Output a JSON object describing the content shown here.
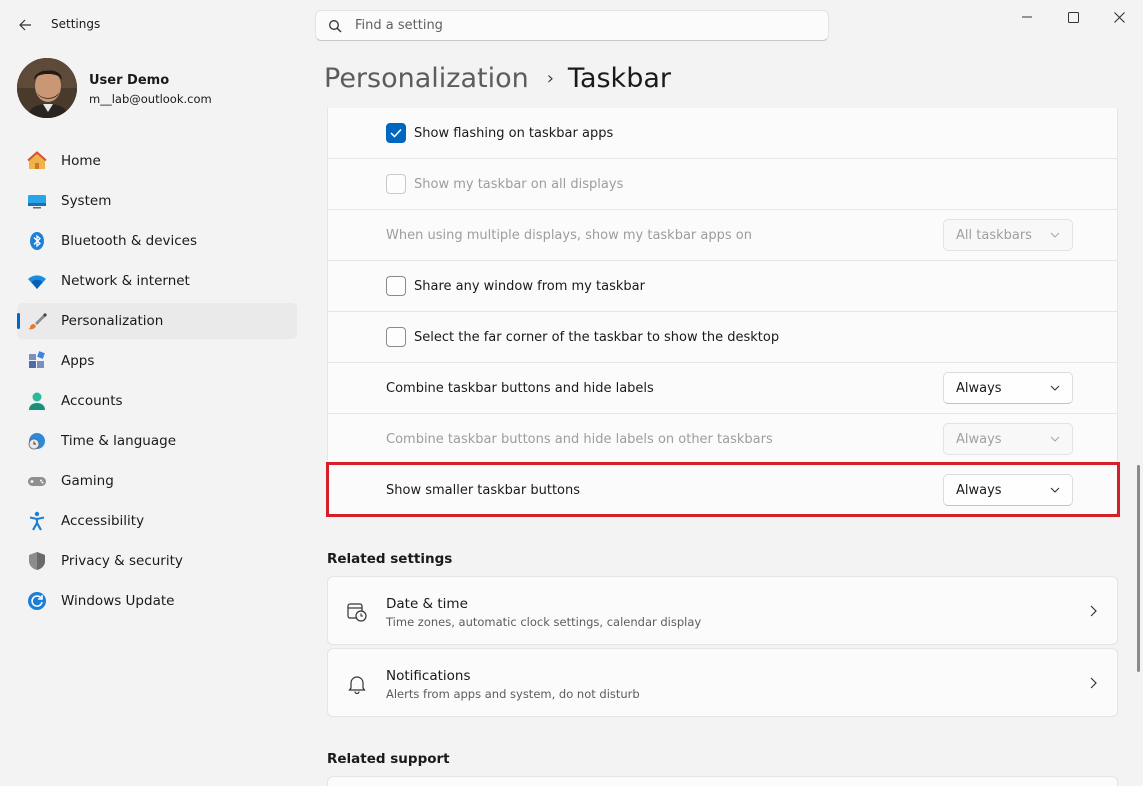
{
  "window": {
    "app_title": "Settings",
    "search_placeholder": "Find a setting"
  },
  "profile": {
    "name": "User Demo",
    "email": "m__lab@outlook.com"
  },
  "sidebar": {
    "items": [
      {
        "label": "Home",
        "icon": "home-icon"
      },
      {
        "label": "System",
        "icon": "system-display-icon"
      },
      {
        "label": "Bluetooth & devices",
        "icon": "bluetooth-icon"
      },
      {
        "label": "Network & internet",
        "icon": "wifi-icon"
      },
      {
        "label": "Personalization",
        "icon": "paintbrush-icon",
        "selected": true
      },
      {
        "label": "Apps",
        "icon": "apps-icon"
      },
      {
        "label": "Accounts",
        "icon": "person-icon"
      },
      {
        "label": "Time & language",
        "icon": "globe-clock-icon"
      },
      {
        "label": "Gaming",
        "icon": "gamepad-icon"
      },
      {
        "label": "Accessibility",
        "icon": "accessibility-icon"
      },
      {
        "label": "Privacy & security",
        "icon": "shield-icon"
      },
      {
        "label": "Windows Update",
        "icon": "update-icon"
      }
    ]
  },
  "breadcrumb": {
    "parent": "Personalization",
    "separator": "›",
    "current": "Taskbar"
  },
  "settings": {
    "show_flashing": {
      "label": "Show flashing on taskbar apps",
      "checked": true
    },
    "show_all_displays": {
      "label": "Show my taskbar on all displays",
      "checked": false,
      "disabled": true
    },
    "multiple_displays": {
      "label": "When using multiple displays, show my taskbar apps on",
      "value": "All taskbars",
      "disabled": true
    },
    "share_window": {
      "label": "Share any window from my taskbar",
      "checked": false
    },
    "far_corner": {
      "label": "Select the far corner of the taskbar to show the desktop",
      "checked": false
    },
    "combine_buttons": {
      "label": "Combine taskbar buttons and hide labels",
      "value": "Always"
    },
    "combine_other": {
      "label": "Combine taskbar buttons and hide labels on other taskbars",
      "value": "Always",
      "disabled": true
    },
    "smaller_buttons": {
      "label": "Show smaller taskbar buttons",
      "value": "Always"
    }
  },
  "related_settings": {
    "title": "Related settings",
    "date_time": {
      "title": "Date & time",
      "subtitle": "Time zones, automatic clock settings, calendar display"
    },
    "notifications": {
      "title": "Notifications",
      "subtitle": "Alerts from apps and system, do not disturb"
    }
  },
  "related_support": {
    "title": "Related support"
  },
  "colors": {
    "accent": "#0067c0",
    "highlight": "#d5202a"
  }
}
